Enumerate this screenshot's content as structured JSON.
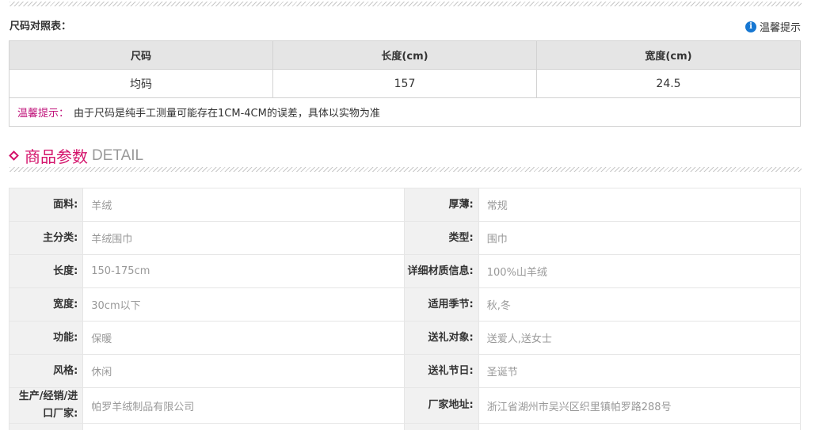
{
  "size_chart": {
    "title": "尺码对照表：",
    "tip_label": "温馨提示",
    "headers": [
      "尺码",
      "长度(cm)",
      "宽度(cm)"
    ],
    "rows": [
      [
        "均码",
        "157",
        "24.5"
      ]
    ],
    "note_label": "温馨提示：",
    "note_text": "由于尺码是纯手工测量可能存在1CM-4CM的误差，具体以实物为准"
  },
  "detail": {
    "title_cn": "商品参数",
    "title_en": "DETAIL",
    "rows": [
      [
        {
          "k": "面料:",
          "v": "羊绒"
        },
        {
          "k": "厚薄:",
          "v": "常规"
        }
      ],
      [
        {
          "k": "主分类:",
          "v": "羊绒围巾"
        },
        {
          "k": "类型:",
          "v": "围巾"
        }
      ],
      [
        {
          "k": "长度:",
          "v": "150-175cm"
        },
        {
          "k": "详细材质信息:",
          "v": "100%山羊绒"
        }
      ],
      [
        {
          "k": "宽度:",
          "v": "30cm以下"
        },
        {
          "k": "适用季节:",
          "v": "秋,冬"
        }
      ],
      [
        {
          "k": "功能:",
          "v": "保暖"
        },
        {
          "k": "送礼对象:",
          "v": "送爱人,送女士"
        }
      ],
      [
        {
          "k": "风格:",
          "v": "休闲"
        },
        {
          "k": "送礼节日:",
          "v": "圣诞节"
        }
      ],
      [
        {
          "k": "生产/经销/进口厂家:",
          "v": "帕罗羊绒制品有限公司"
        },
        {
          "k": "厂家地址:",
          "v": "浙江省湖州市吴兴区织里镇帕罗路288号"
        }
      ]
    ]
  },
  "colors": {
    "accent": "#d4136b",
    "note": "#c0147b",
    "info": "#1677d2"
  }
}
